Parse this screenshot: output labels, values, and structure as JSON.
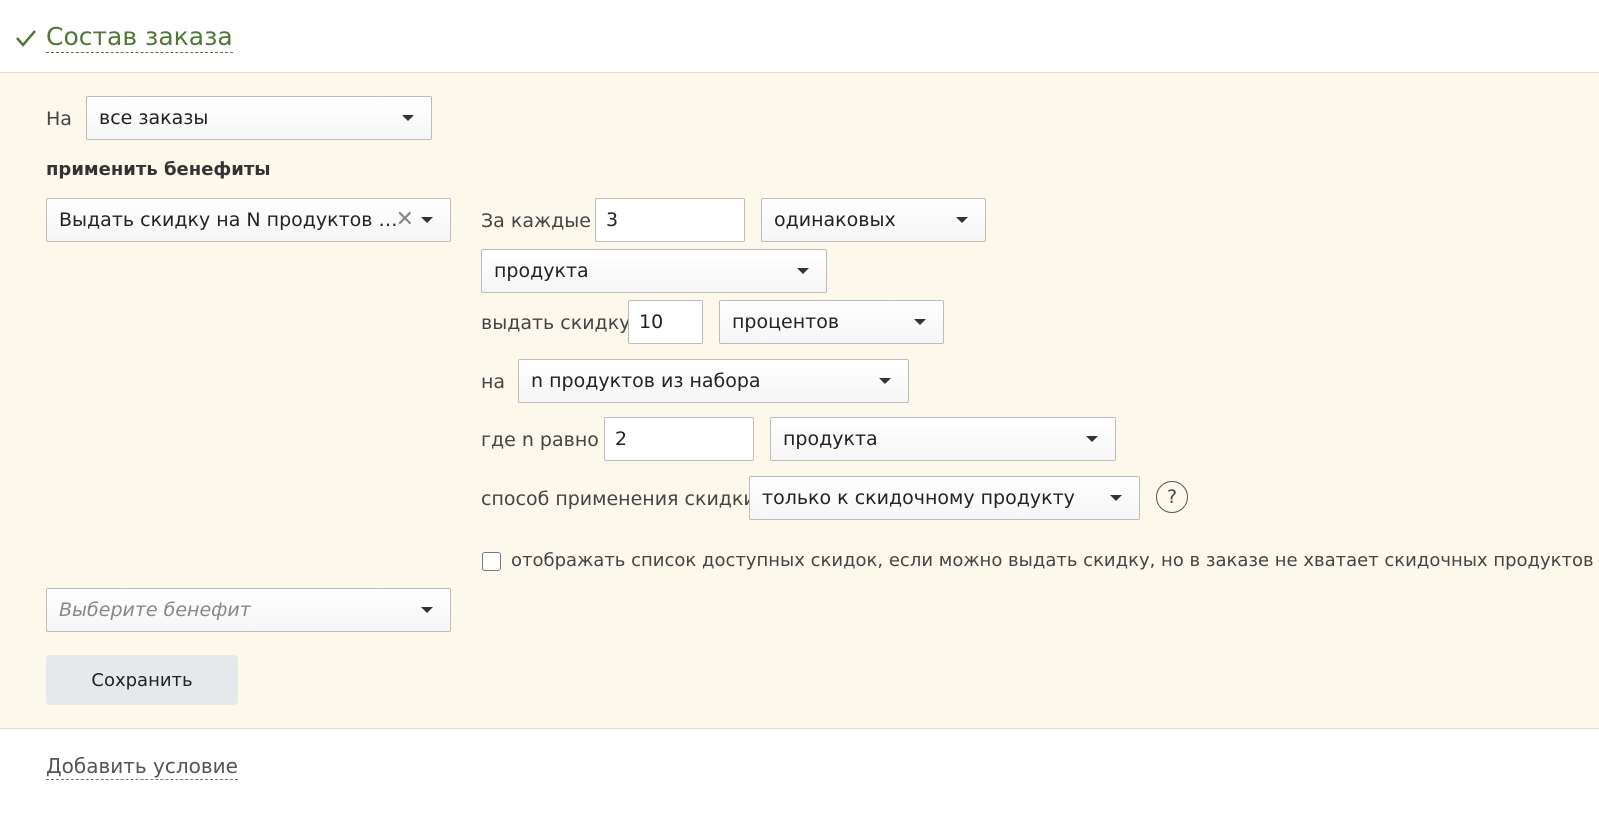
{
  "header": {
    "title": "Состав заказа",
    "check_icon": "check-icon",
    "title_color": "#4e7a34"
  },
  "scope": {
    "label": "На",
    "select_value": "все заказы"
  },
  "benefits": {
    "heading": "применить бенефиты",
    "selected_benefit": "Выдать скидку на N продуктов при ...",
    "new_benefit_placeholder": "Выберите бенефит"
  },
  "rule": {
    "for_each_label": "За каждые",
    "for_each_count": "3",
    "kind_select": "одинаковых",
    "unit_select": "продукта",
    "give_discount_label": "выдать скидку",
    "discount_value": "10",
    "discount_type_select": "процентов",
    "on_label": "на",
    "target_select": "n продуктов из набора",
    "where_n_label": "где n равно",
    "n_value": "2",
    "n_unit_select": "продукта",
    "method_label": "способ применения скидки",
    "method_select": "только к скидочному продукту",
    "help_symbol": "?",
    "show_list_checkbox_checked": false,
    "show_list_label": "отображать список доступных скидок, если можно выдать скидку, но в заказе не хватает скидочных продуктов"
  },
  "actions": {
    "save_label": "Сохранить",
    "add_condition_label": "Добавить условие"
  },
  "colors": {
    "panel_bg": "#fcf9ec",
    "button_bg": "#e6e9ec"
  }
}
